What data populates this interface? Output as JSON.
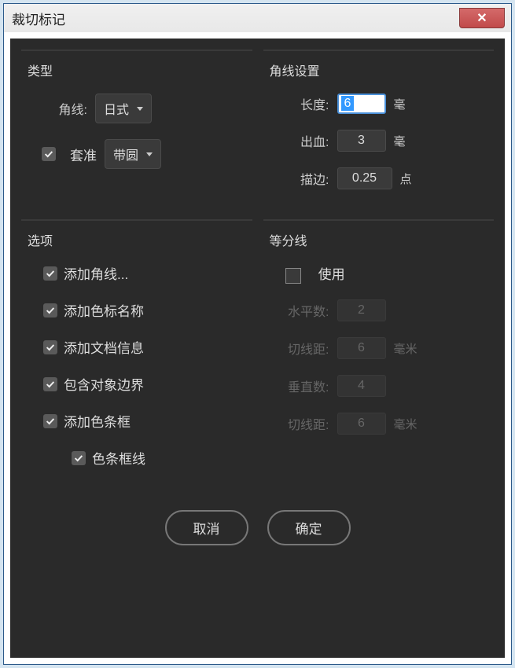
{
  "window": {
    "title": "裁切标记",
    "close_glyph": "✕"
  },
  "type_group": {
    "title": "类型",
    "corner_label": "角线:",
    "corner_value": "日式",
    "register_ck_label": "套准",
    "register_value": "带圆"
  },
  "corner_settings_group": {
    "title": "角线设置",
    "length_label": "长度:",
    "length_value": "6",
    "length_unit": "毫",
    "bleed_label": "出血:",
    "bleed_value": "3",
    "bleed_unit": "毫",
    "stroke_label": "描边:",
    "stroke_value": "0.25",
    "stroke_unit": "点"
  },
  "options_group": {
    "title": "选项",
    "items": {
      "add_corner": "添加角线...",
      "add_color_name": "添加色标名称",
      "add_doc_info": "添加文档信息",
      "include_obj_bounds": "包含对象边界",
      "add_color_bar": "添加色条框",
      "color_bar_line": "色条框线"
    }
  },
  "divide_group": {
    "title": "等分线",
    "use_label": "使用",
    "h_count_label": "水平数:",
    "h_count_value": "2",
    "v_gap_label": "切线距:",
    "v_gap_value": "6",
    "v_gap_unit": "毫米",
    "v_count_label": "垂直数:",
    "v_count_value": "4",
    "h_gap_label": "切线距:",
    "h_gap_value": "6",
    "h_gap_unit": "毫米"
  },
  "buttons": {
    "cancel": "取消",
    "ok": "确定"
  }
}
